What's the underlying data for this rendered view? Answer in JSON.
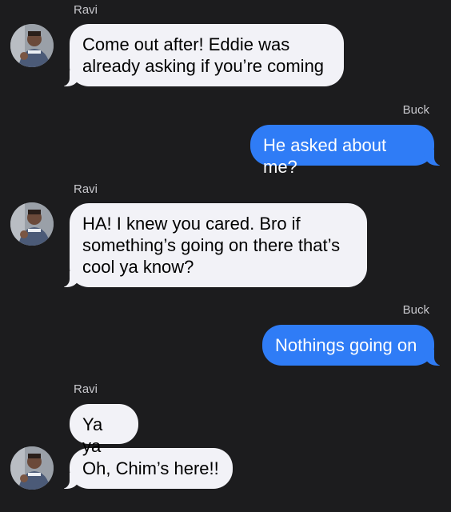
{
  "conversation": {
    "messages": [
      {
        "sender": "Ravi",
        "text": "Come out after! Eddie was already asking if you’re coming",
        "direction": "incoming"
      },
      {
        "sender": "Buck",
        "text": "He asked about me?",
        "direction": "outgoing"
      },
      {
        "sender": "Ravi",
        "text": "HA! I knew you cared. Bro if something’s going on there that’s cool ya know?",
        "direction": "incoming"
      },
      {
        "sender": "Buck",
        "text": "Nothings going on",
        "direction": "outgoing"
      },
      {
        "sender": "Ravi",
        "text": "Ya ya",
        "direction": "incoming"
      },
      {
        "sender": "Ravi",
        "text": "Oh, Chim’s here!!",
        "direction": "incoming"
      }
    ]
  },
  "colors": {
    "background": "#1c1c1e",
    "incoming_bubble": "#f2f2f7",
    "outgoing_bubble": "#2f7cf6"
  },
  "icons": {
    "avatar": "contact-photo"
  }
}
